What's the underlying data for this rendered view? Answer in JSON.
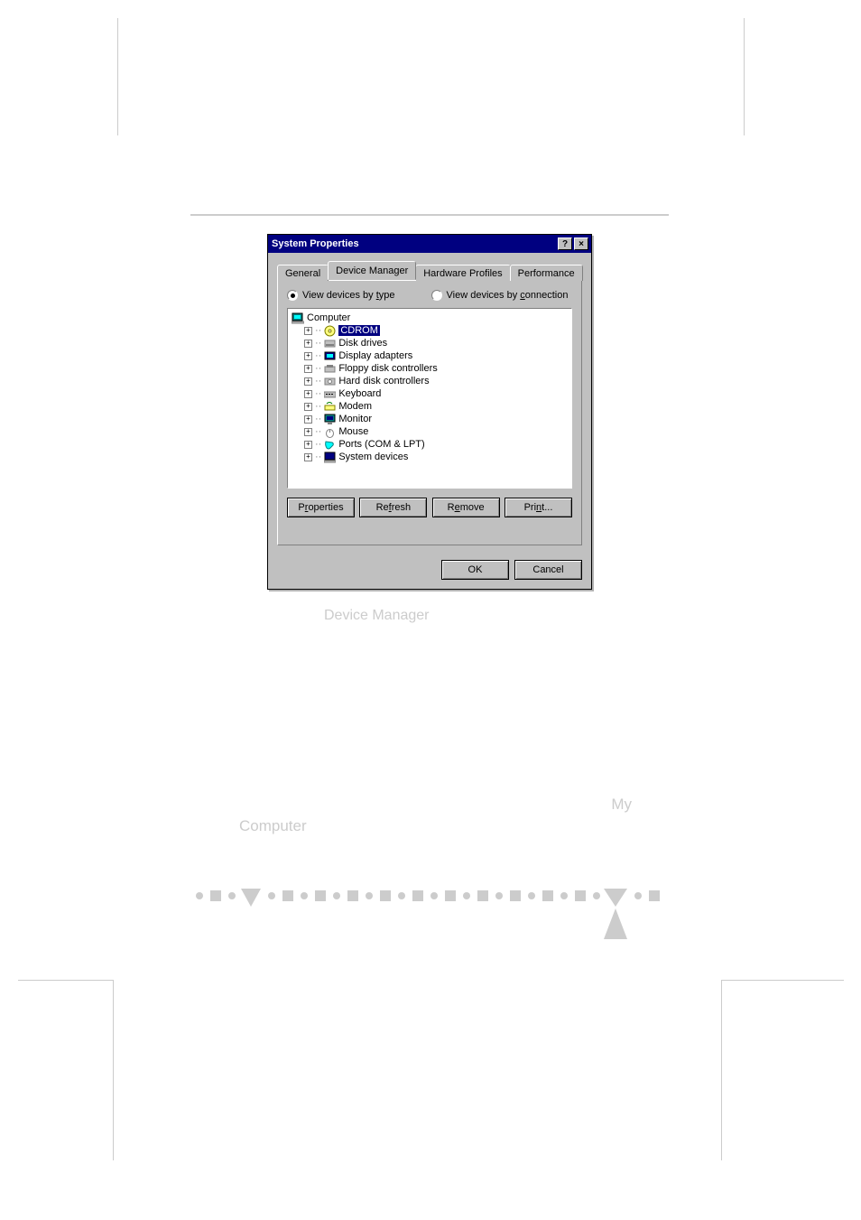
{
  "dialog": {
    "title": "System Properties",
    "help_btn": "?",
    "close_btn": "×",
    "tabs": {
      "general": "General",
      "device_manager": "Device Manager",
      "hardware_profiles": "Hardware Profiles",
      "performance": "Performance"
    },
    "radios": {
      "by_type_pre": "View devices by ",
      "by_type_u": "t",
      "by_type_post": "ype",
      "by_conn_pre": "View devices by ",
      "by_conn_u": "c",
      "by_conn_post": "onnection"
    },
    "tree": {
      "root": "Computer",
      "items": [
        {
          "icon": "cd-icon",
          "label": "CDROM",
          "selected": true
        },
        {
          "icon": "disk-icon",
          "label": "Disk drives"
        },
        {
          "icon": "display-icon",
          "label": "Display adapters"
        },
        {
          "icon": "floppy-ctl-icon",
          "label": "Floppy disk controllers"
        },
        {
          "icon": "hdd-ctl-icon",
          "label": "Hard disk controllers"
        },
        {
          "icon": "keyboard-icon",
          "label": "Keyboard"
        },
        {
          "icon": "modem-icon",
          "label": "Modem"
        },
        {
          "icon": "monitor-icon",
          "label": "Monitor"
        },
        {
          "icon": "mouse-icon",
          "label": "Mouse"
        },
        {
          "icon": "ports-icon",
          "label": "Ports (COM & LPT)"
        },
        {
          "icon": "system-icon",
          "label": "System devices"
        }
      ]
    },
    "buttons": {
      "properties_pre": "P",
      "properties_u": "r",
      "properties_post": "operties",
      "refresh_pre": "Re",
      "refresh_u": "f",
      "refresh_post": "resh",
      "remove_pre": "R",
      "remove_u": "e",
      "remove_post": "move",
      "print_pre": "Pri",
      "print_u": "n",
      "print_post": "t...",
      "ok": "OK",
      "cancel": "Cancel"
    }
  },
  "caption": "Device Manager",
  "body": {
    "line1_end": "My",
    "line2_start": "Computer"
  }
}
